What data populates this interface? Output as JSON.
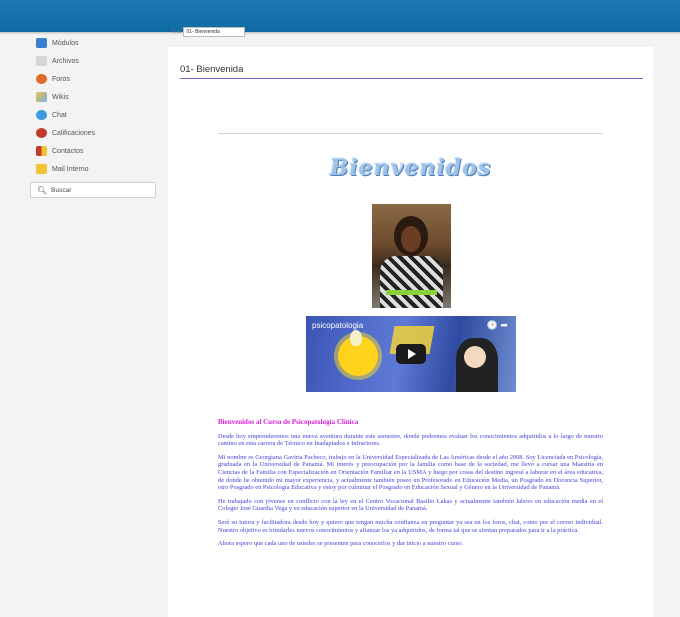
{
  "sidebar": {
    "items": [
      {
        "label": "Módulos",
        "icon": "modules-icon",
        "color": "#3b7fd0"
      },
      {
        "label": "Archivos",
        "icon": "files-icon",
        "color": "#c9c9c9"
      },
      {
        "label": "Foros",
        "icon": "forums-icon",
        "color": "#e06a2b"
      },
      {
        "label": "Wikis",
        "icon": "wiki-icon",
        "color": "#e8c34a"
      },
      {
        "label": "Chat",
        "icon": "chat-icon",
        "color": "#3a9be0"
      },
      {
        "label": "Calificaciones",
        "icon": "grades-icon",
        "color": "#c0392b"
      },
      {
        "label": "Contactos",
        "icon": "contacts-icon",
        "color": "#c0392b"
      },
      {
        "label": "Mail Interno",
        "icon": "mail-icon",
        "color": "#f1c232"
      }
    ],
    "search_label": "Buscar"
  },
  "jump": {
    "label": "Ir a:",
    "selected": "01- Bienvenida"
  },
  "content": {
    "title": "01- Bienvenida",
    "welcome_banner": "Bienvenidos",
    "video_title": "psicopatologia",
    "video_controls": "🕒 ➦",
    "heading": "Bienvenidos al Curso de Psicopatología Clínica",
    "paragraphs": [
      "Desde hoy emprenderemos una nueva aventura durante este semestre, donde podremos evaluar los conocimientos adquiridos a lo largo de nuestro camino en esta carrera de Técnico en Inadaptados e Infractores.",
      "Mi nombre es Georgiana Gaviria Pacheco, trabajo en la Universidad Especializada de Las Américas desde el año 2008. Soy Licenciada en Psicología, graduada en la Universidad de Panamá. Mi interés y preocupación por la familia como base de la sociedad, me llevó a cursar una Maestría en Ciencias de la Familia con Especialización en Orientación Familiar en la USMA y luego por cosas del destino ingresé a laborar en el área educativa, de donde he obtenido mi mayor experiencia, y actualmente también poseo un Profesorado en Educación Media, un Posgrado en Docencia Superior, otro Posgrado en Psicología Educativa y estoy por culminar el Posgrado en Educación Sexual y Género en la Universidad de Panamá.",
      "He trabajado con jóvenes en conflicto con la ley en el Centro Vocacional Basilio Lakas y actualmente también laboro en educación media en el Colegio José Guardia Vega y en educación superior en la Universidad de Panamá.",
      "Seré su tutora y facilitadora desde hoy y quiero que tengan mucha confianza en preguntar ya sea en los foros, chat, como por el correo individual. Nuestro objetivo es brindarles nuevos conocimientos y afianzar los ya adquiridos, de forma tal que se sientan preparados para ir a la práctica.",
      "Ahora espero que cada uno de ustedes se presenten para conocerlos y dar inicio a nuestro curso."
    ]
  }
}
